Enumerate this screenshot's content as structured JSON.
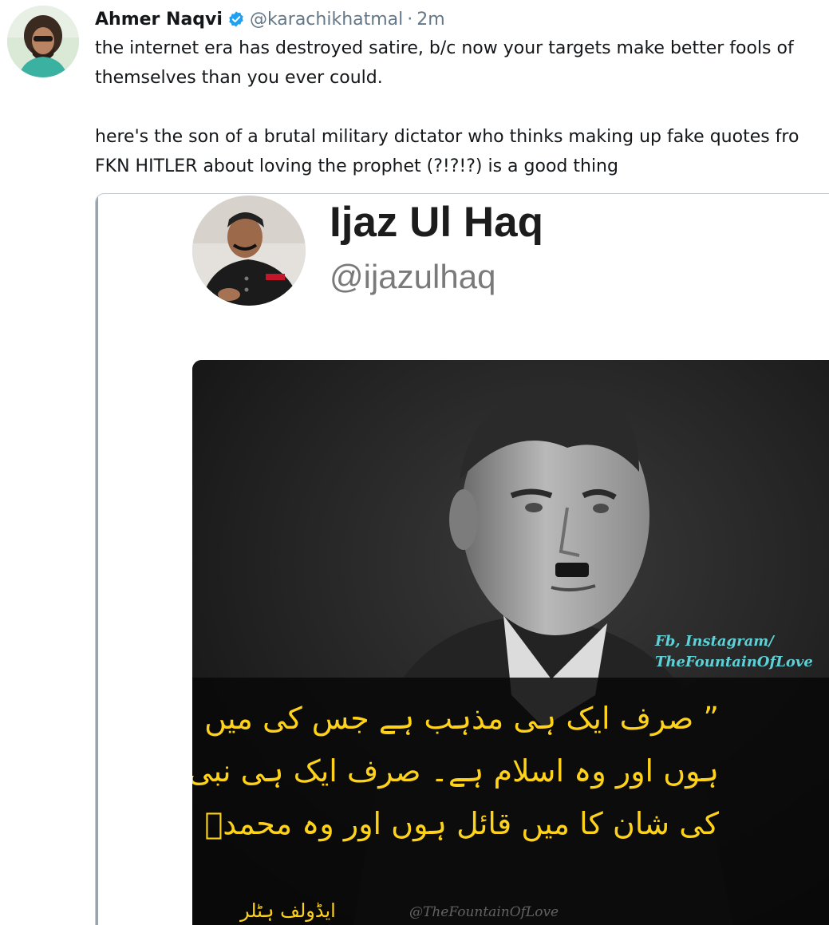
{
  "tweet": {
    "author_name": "Ahmer Naqvi",
    "handle": "@karachikhatmal",
    "separator": "·",
    "time": "2m",
    "text_lines": [
      "the internet era has destroyed satire, b/c now your targets make better fools of",
      "themselves than you ever could.",
      "here's the son of a brutal military dictator who thinks making up fake quotes fro",
      "FKN HITLER about loving the prophet (?!?!?) is a good thing"
    ],
    "icons": {
      "avatar": "avatar",
      "verified": "verified-badge-icon"
    },
    "colors": {
      "name": "#14171a",
      "meta": "#657786",
      "verified": "#1da1f2"
    }
  },
  "embedded_image": {
    "profile_name": "Ijaz Ul Haq",
    "profile_handle": "@ijazulhaq",
    "credit_line_1": "Fb, Instagram/",
    "credit_line_2": "TheFountainOfLove",
    "quote_lines": [
      "” صرف ایک ہی مذہب ہے جس کی میں عزت کرتا",
      "ہوں اور وہ اسلام ہے۔ صرف ایک ہی نبیؐ ہے جس",
      "کی شان کا میں قائل ہوں اور وہ محمدؐ ہیں۔۔“"
    ],
    "quote_attribution": "ایڈولف ہٹلر",
    "watermark": "@TheFountainOfLove",
    "colors": {
      "quote_text": "#ffd21a",
      "credit_text": "#5fd0d6"
    }
  }
}
